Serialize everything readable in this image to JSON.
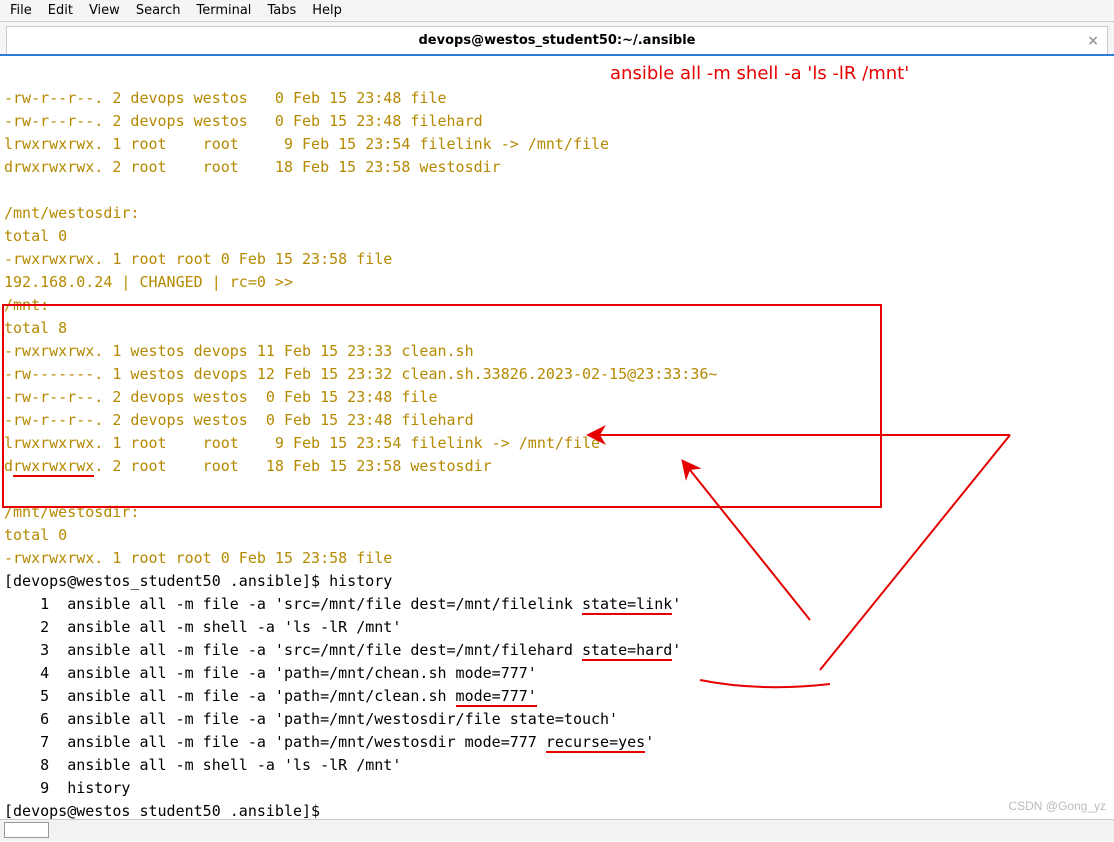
{
  "menubar": {
    "file": "File",
    "edit": "Edit",
    "view": "View",
    "search": "Search",
    "terminal": "Terminal",
    "tabs": "Tabs",
    "help": "Help"
  },
  "tab": {
    "title": "devops@westos_student50:~/.ansible",
    "close": "×"
  },
  "annotation": {
    "cmd": "ansible all -m shell -a 'ls -lR /mnt'"
  },
  "term": {
    "l01": "-rw-r--r--. 2 devops westos   0 Feb 15 23:48 file",
    "l02": "-rw-r--r--. 2 devops westos   0 Feb 15 23:48 filehard",
    "l03": "lrwxrwxrwx. 1 root    root     9 Feb 15 23:54 filelink -> /mnt/file",
    "l04": "drwxrwxrwx. 2 root    root    18 Feb 15 23:58 westosdir",
    "l05": "",
    "l06": "/mnt/westosdir:",
    "l07": "total 0",
    "l08": "-rwxrwxrwx. 1 root root 0 Feb 15 23:58 file",
    "l09": "192.168.0.24 | CHANGED | rc=0 >>",
    "l10": "/mnt:",
    "l11": "total 8",
    "l12": "-rwxrwxrwx. 1 westos devops 11 Feb 15 23:33 clean.sh",
    "l13": "-rw-------. 1 westos devops 12 Feb 15 23:32 clean.sh.33826.2023-02-15@23:33:36~",
    "l14": "-rw-r--r--. 2 devops westos  0 Feb 15 23:48 file",
    "l15": "-rw-r--r--. 2 devops westos  0 Feb 15 23:48 filehard",
    "l16": "lrwxrwxrwx. 1 root    root    9 Feb 15 23:54 filelink -> /mnt/file",
    "l17a": "d",
    "l17b": "rwxrwxrwx",
    "l17c": ". 2 root    root   18 Feb 15 23:58 westosdir",
    "l18": "",
    "l19": "/mnt/westosdir:",
    "l20": "total 0",
    "l21": "-rwxrwxrwx. 1 root root 0 Feb 15 23:58 file",
    "p1a": "[devops@westos_student50 .ansible]$ ",
    "p1b": "history",
    "h1a": "    1  ansible all -m file -a 'src=/mnt/file dest=/mnt/filelink ",
    "h1b": "state=link",
    "h1c": "'",
    "h2": "    2  ansible all -m shell -a 'ls -lR /mnt'",
    "h3a": "    3  ansible all -m file -a 'src=/mnt/file dest=/mnt/filehard ",
    "h3b": "state=hard",
    "h3c": "'",
    "h4": "    4  ansible all -m file -a 'path=/mnt/chean.sh mode=777'",
    "h5a": "    5  ansible all -m file -a 'path=/mnt/clean.sh ",
    "h5b": "mode=777'",
    "h6": "    6  ansible all -m file -a 'path=/mnt/westosdir/file state=touch'",
    "h7a": "    7  ansible all -m file -a 'path=/mnt/westosdir mode=777 ",
    "h7b": "recurse=yes",
    "h7c": "'",
    "h8": "    8  ansible all -m shell -a 'ls -lR /mnt'",
    "h9": "    9  history",
    "p2": "[devops@westos_student50 .ansible]$ "
  },
  "watermark": "CSDN @Gong_yz"
}
